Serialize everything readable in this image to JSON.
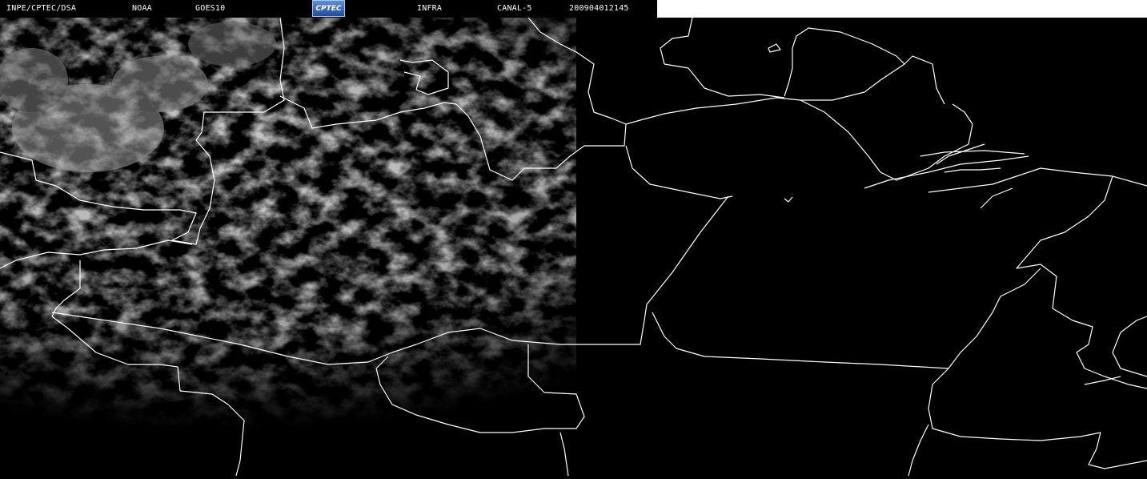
{
  "header": {
    "org": "INPE/CPTEC/DSA",
    "agency": "NOAA",
    "satellite": "GOES10",
    "logo_text": "CPTEC",
    "product": "INFRA",
    "channel": "CANAL-5",
    "timestamp": "200904012145"
  },
  "colors": {
    "background": "#000000",
    "borders": "#ffffff",
    "clouds": "#8a8a8a",
    "header_blank": "#ffffff"
  }
}
